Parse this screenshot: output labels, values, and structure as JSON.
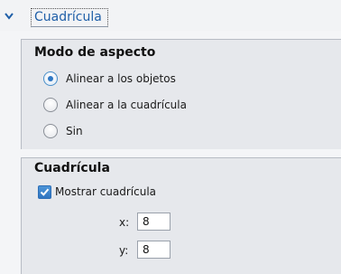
{
  "header": {
    "title": "Cuadrícula"
  },
  "aspect_mode": {
    "title": "Modo de aspecto",
    "options": [
      {
        "label": "Alinear a los objetos",
        "selected": true
      },
      {
        "label": "Alinear a la cuadrícula",
        "selected": false
      },
      {
        "label": "Sin",
        "selected": false
      }
    ]
  },
  "grid": {
    "title": "Cuadrícula",
    "show_grid": {
      "label": "Mostrar cuadrícula",
      "checked": true
    },
    "x": {
      "label": "x:",
      "value": "8"
    },
    "y": {
      "label": "y:",
      "value": "8"
    }
  },
  "colors": {
    "accent": "#2f78c4",
    "title_link": "#1f5fa8",
    "section_bg": "#e6e8ec",
    "page_bg": "#f4f5f7"
  },
  "icons": {
    "collapse": "chevron-down-icon",
    "radio_selected": "radio-selected-icon",
    "checkbox_checked": "checkmark-icon"
  }
}
